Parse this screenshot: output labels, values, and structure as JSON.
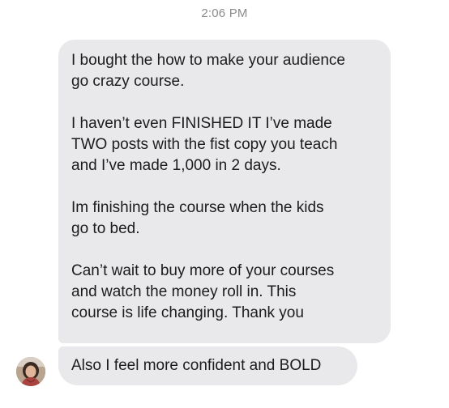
{
  "thread": {
    "timestamp": "2:06 PM"
  },
  "messages": [
    {
      "paragraphs": [
        "I bought the how to make your audience\ngo crazy course.",
        "I haven’t even FINISHED IT I’ve made\nTWO posts with the fist copy you teach\nand I’ve made 1,000 in 2 days.",
        "Im finishing the course when the kids\ngo to bed.",
        "Can’t wait to buy more of your courses\nand watch the money roll in. This\ncourse is life changing. Thank you"
      ]
    },
    {
      "text": "Also I feel more confident and BOLD"
    }
  ],
  "sender": {
    "avatar_icon": "user-avatar-photo"
  },
  "colors": {
    "bubble": "#e9e9eb",
    "text": "#1c1c1e",
    "timestamp": "#8a8a8e"
  }
}
